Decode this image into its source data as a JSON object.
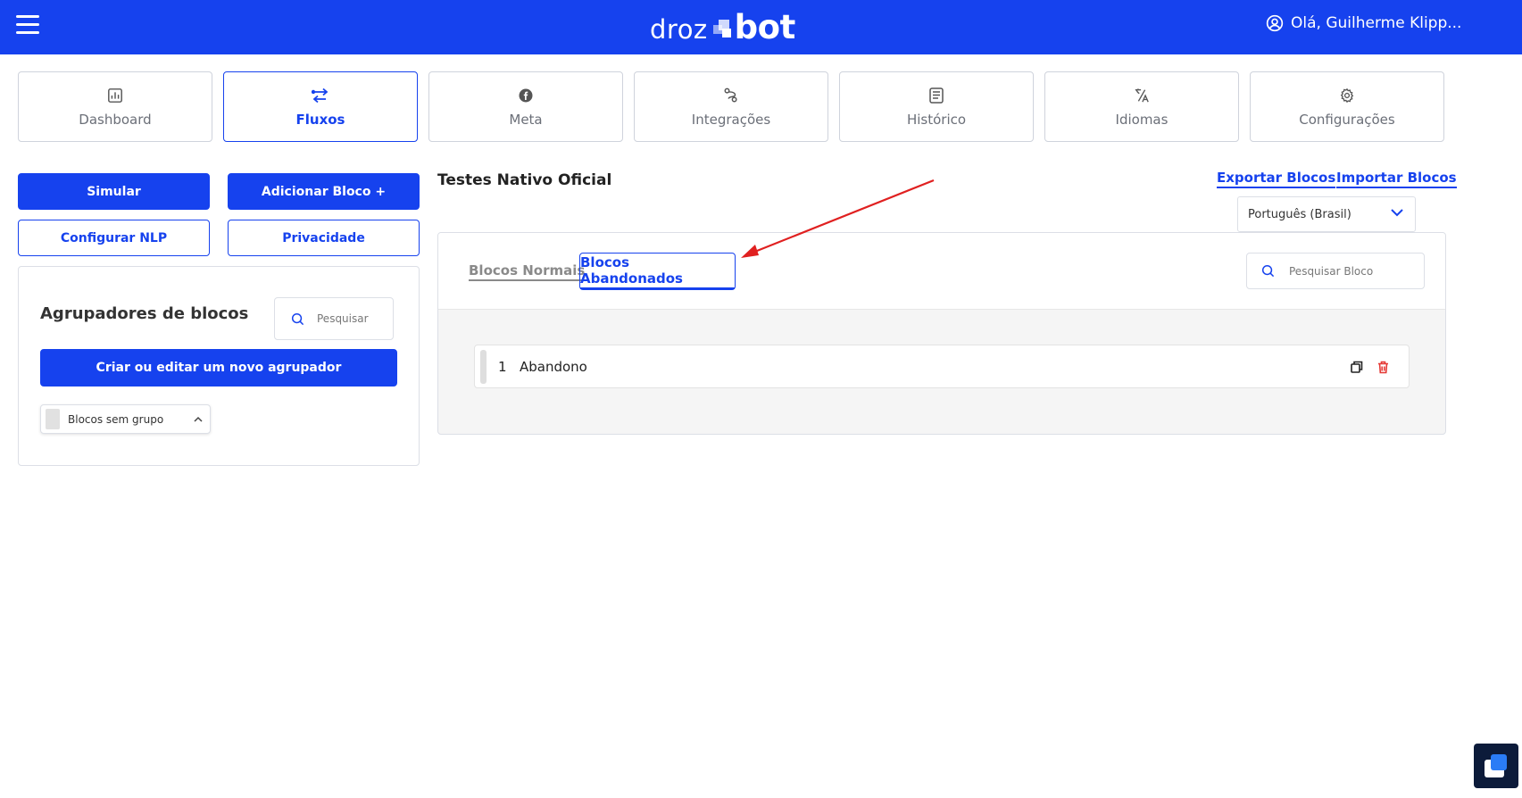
{
  "header": {
    "logo_left": "droz",
    "logo_right": "bot",
    "user_greeting": "Olá, Guilherme Klipp..."
  },
  "nav": {
    "items": [
      {
        "label": "Dashboard",
        "icon": "dashboard-icon",
        "active": false
      },
      {
        "label": "Fluxos",
        "icon": "flows-icon",
        "active": true
      },
      {
        "label": "Meta",
        "icon": "meta-icon",
        "active": false
      },
      {
        "label": "Integrações",
        "icon": "integrations-icon",
        "active": false
      },
      {
        "label": "Histórico",
        "icon": "history-icon",
        "active": false
      },
      {
        "label": "Idiomas",
        "icon": "translate-icon",
        "active": false
      },
      {
        "label": "Configurações",
        "icon": "gear-icon",
        "active": false
      }
    ]
  },
  "actions": {
    "simulate": "Simular",
    "add_block": "Adicionar Bloco +",
    "configure_nlp": "Configurar NLP",
    "privacy": "Privacidade"
  },
  "groupers": {
    "title": "Agrupadores de blocos",
    "search_placeholder": "Pesquisar",
    "create_button": "Criar ou editar um novo agrupador",
    "chip_label": "Blocos sem grupo"
  },
  "main": {
    "flow_title": "Testes Nativo Oficial",
    "export_link": "Exportar Blocos",
    "import_link": "Importar Blocos",
    "language": "Português (Brasil)",
    "tabs": [
      {
        "label": "Blocos Normais",
        "active": false
      },
      {
        "label": "Blocos Abandonados",
        "active": true
      }
    ],
    "block_search_placeholder": "Pesquisar Bloco",
    "blocks": [
      {
        "index": "1",
        "name": "Abandono"
      }
    ]
  },
  "colors": {
    "brand": "#1642ee",
    "delete": "#e53935",
    "annotation": "#e02020"
  }
}
